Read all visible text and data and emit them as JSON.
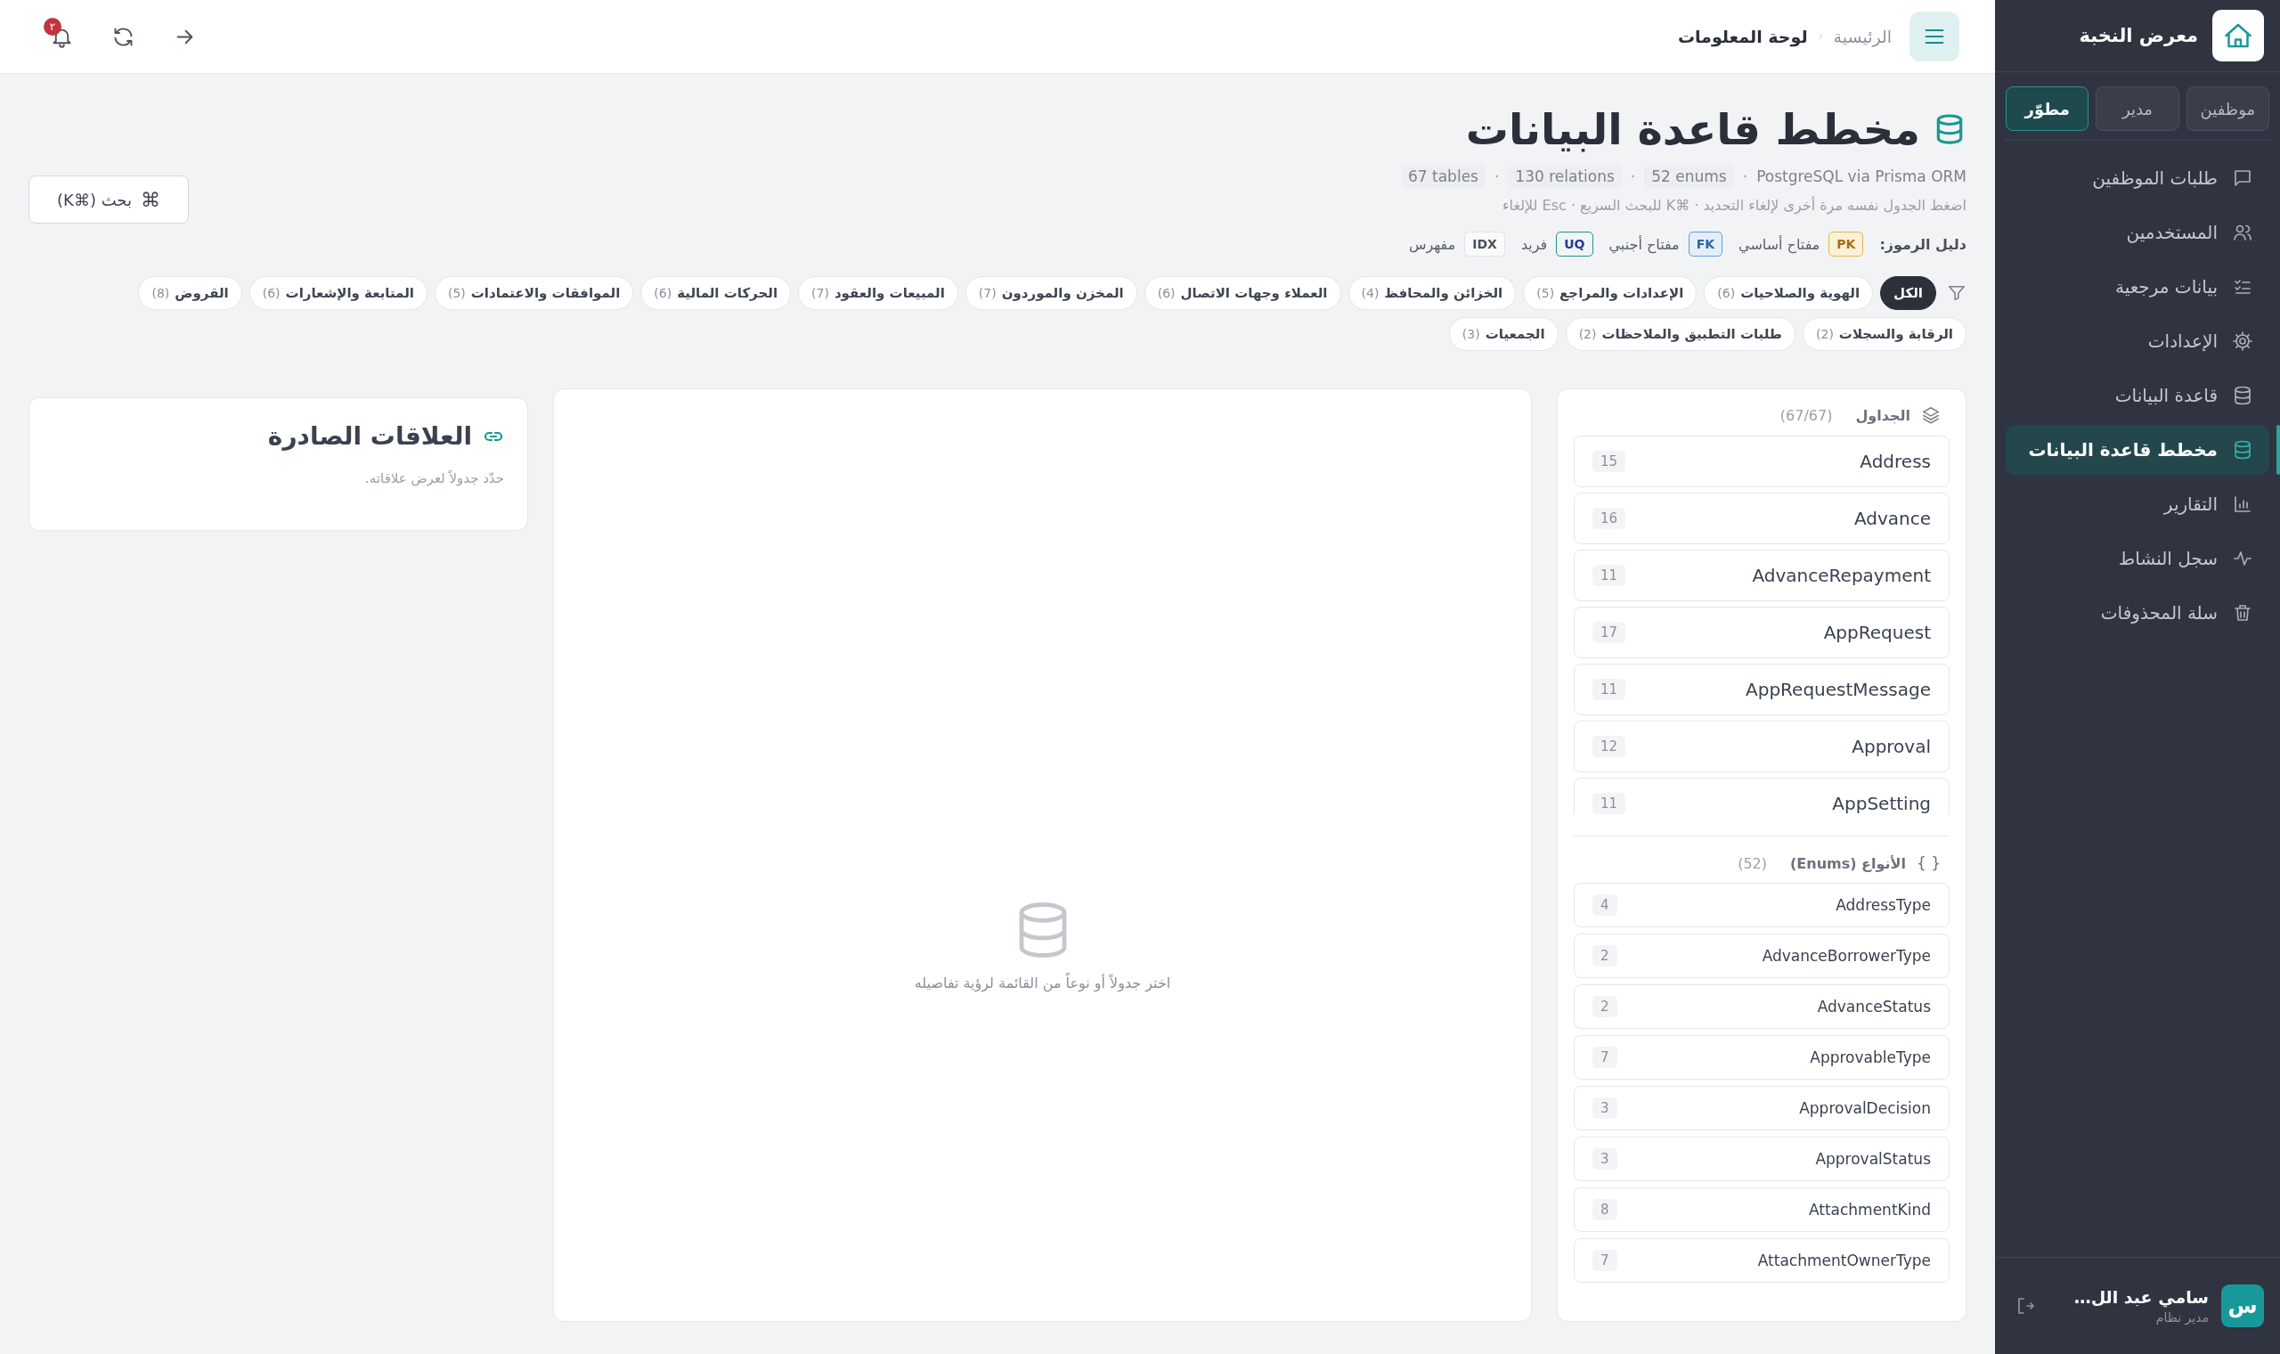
{
  "topbar": {
    "breadcrumb": [
      {
        "label": "الرئيسية",
        "current": false
      },
      {
        "label": "لوحة المعلومات",
        "current": true
      }
    ],
    "notifications_badge": "٢"
  },
  "sidebar": {
    "brand": "معرض النخبة",
    "roles": [
      {
        "label": "موظفين",
        "selected": false
      },
      {
        "label": "مدير",
        "selected": false
      },
      {
        "label": "مطوّر",
        "selected": true
      }
    ],
    "nav": [
      {
        "label": "طلبات الموظفين",
        "selected": false
      },
      {
        "label": "المستخدمين",
        "selected": false
      },
      {
        "label": "بيانات مرجعية",
        "selected": false
      },
      {
        "label": "الإعدادات",
        "selected": false
      },
      {
        "label": "قاعدة البيانات",
        "selected": false
      },
      {
        "label": "مخطط قاعدة البيانات",
        "selected": true
      },
      {
        "label": "التقارير",
        "selected": false
      },
      {
        "label": "سجل النشاط",
        "selected": false
      },
      {
        "label": "سلة المحذوفات",
        "selected": false
      }
    ],
    "user": {
      "avatar": "س",
      "name": "سامي عبد الل…",
      "role": "مدير نظام"
    }
  },
  "header": {
    "title": "مخطط قاعدة البيانات",
    "meta": [
      {
        "text": "PostgreSQL via Prisma ORM",
        "kind": "plain"
      },
      {
        "text": "·",
        "kind": "separator"
      },
      {
        "text": "52 enums",
        "kind": "pill"
      },
      {
        "text": "·",
        "kind": "separator"
      },
      {
        "text": "130 relations",
        "kind": "pill"
      },
      {
        "text": "·",
        "kind": "separator"
      },
      {
        "text": "67 tables",
        "kind": "pill"
      }
    ],
    "hint": "اضغط الجدول نفسه مرة أخرى لإلغاء التحديد · ⌘K للبحث السريع · Esc للإلغاء",
    "search": {
      "icon": "⌘",
      "label": "بحث (⌘K)"
    },
    "legend": {
      "label": "دليل الرموز:",
      "items": [
        {
          "code": "PK",
          "label": "مفتاح أساسي",
          "kind": "pk"
        },
        {
          "code": "FK",
          "label": "مفتاح أجنبي",
          "kind": "fk"
        },
        {
          "code": "UQ",
          "label": "فريد",
          "kind": "uq"
        },
        {
          "code": "IDX",
          "label": "مفهرس",
          "kind": "idx"
        }
      ]
    }
  },
  "filters": [
    {
      "label": "الكل",
      "selected": true
    },
    {
      "label": "الهوية والصلاحيات",
      "count": "(6)",
      "selected": false
    },
    {
      "label": "الإعدادات والمراجع",
      "count": "(5)",
      "selected": false
    },
    {
      "label": "الخزائن والمحافظ",
      "count": "(4)",
      "selected": false
    },
    {
      "label": "العملاء وجهات الاتصال",
      "count": "(6)",
      "selected": false
    },
    {
      "label": "المخزن والموردون",
      "count": "(7)",
      "selected": false
    },
    {
      "label": "المبيعات والعقود",
      "count": "(7)",
      "selected": false
    },
    {
      "label": "الحركات المالية",
      "count": "(6)",
      "selected": false
    },
    {
      "label": "الموافقات والاعتمادات",
      "count": "(5)",
      "selected": false
    },
    {
      "label": "المتابعة والإشعارات",
      "count": "(6)",
      "selected": false
    },
    {
      "label": "القروض",
      "count": "(8)",
      "selected": false
    },
    {
      "label": "الرقابة والسجلات",
      "count": "(2)",
      "selected": false
    },
    {
      "label": "طلبات التطبيق والملاحظات",
      "count": "(2)",
      "selected": false
    },
    {
      "label": "الجمعيات",
      "count": "(3)",
      "selected": false
    }
  ],
  "tables": {
    "title": "الجداول",
    "count": "(67/67)",
    "items": [
      {
        "name": "Address",
        "fields": "15"
      },
      {
        "name": "Advance",
        "fields": "16"
      },
      {
        "name": "AdvanceRepayment",
        "fields": "11"
      },
      {
        "name": "AppRequest",
        "fields": "17"
      },
      {
        "name": "AppRequestMessage",
        "fields": "11"
      },
      {
        "name": "Approval",
        "fields": "12"
      },
      {
        "name": "AppSetting",
        "fields": "11"
      }
    ]
  },
  "enums": {
    "icon": "{ }",
    "title": "الأنواع (Enums)",
    "count": "(52)",
    "items": [
      {
        "name": "AddressType",
        "values": "4"
      },
      {
        "name": "AdvanceBorrowerType",
        "values": "2"
      },
      {
        "name": "AdvanceStatus",
        "values": "2"
      },
      {
        "name": "ApprovableType",
        "values": "7"
      },
      {
        "name": "ApprovalDecision",
        "values": "3"
      },
      {
        "name": "ApprovalStatus",
        "values": "3"
      },
      {
        "name": "AttachmentKind",
        "values": "8"
      },
      {
        "name": "AttachmentOwnerType",
        "values": "7"
      }
    ]
  },
  "details": {
    "empty_text": "اختر جدولاً أو نوعاً من القائمة لرؤية تفاصيله"
  },
  "relations": {
    "title": "العلاقات الصادرة",
    "hint": "حدّد جدولاً لعرض علاقاته."
  }
}
